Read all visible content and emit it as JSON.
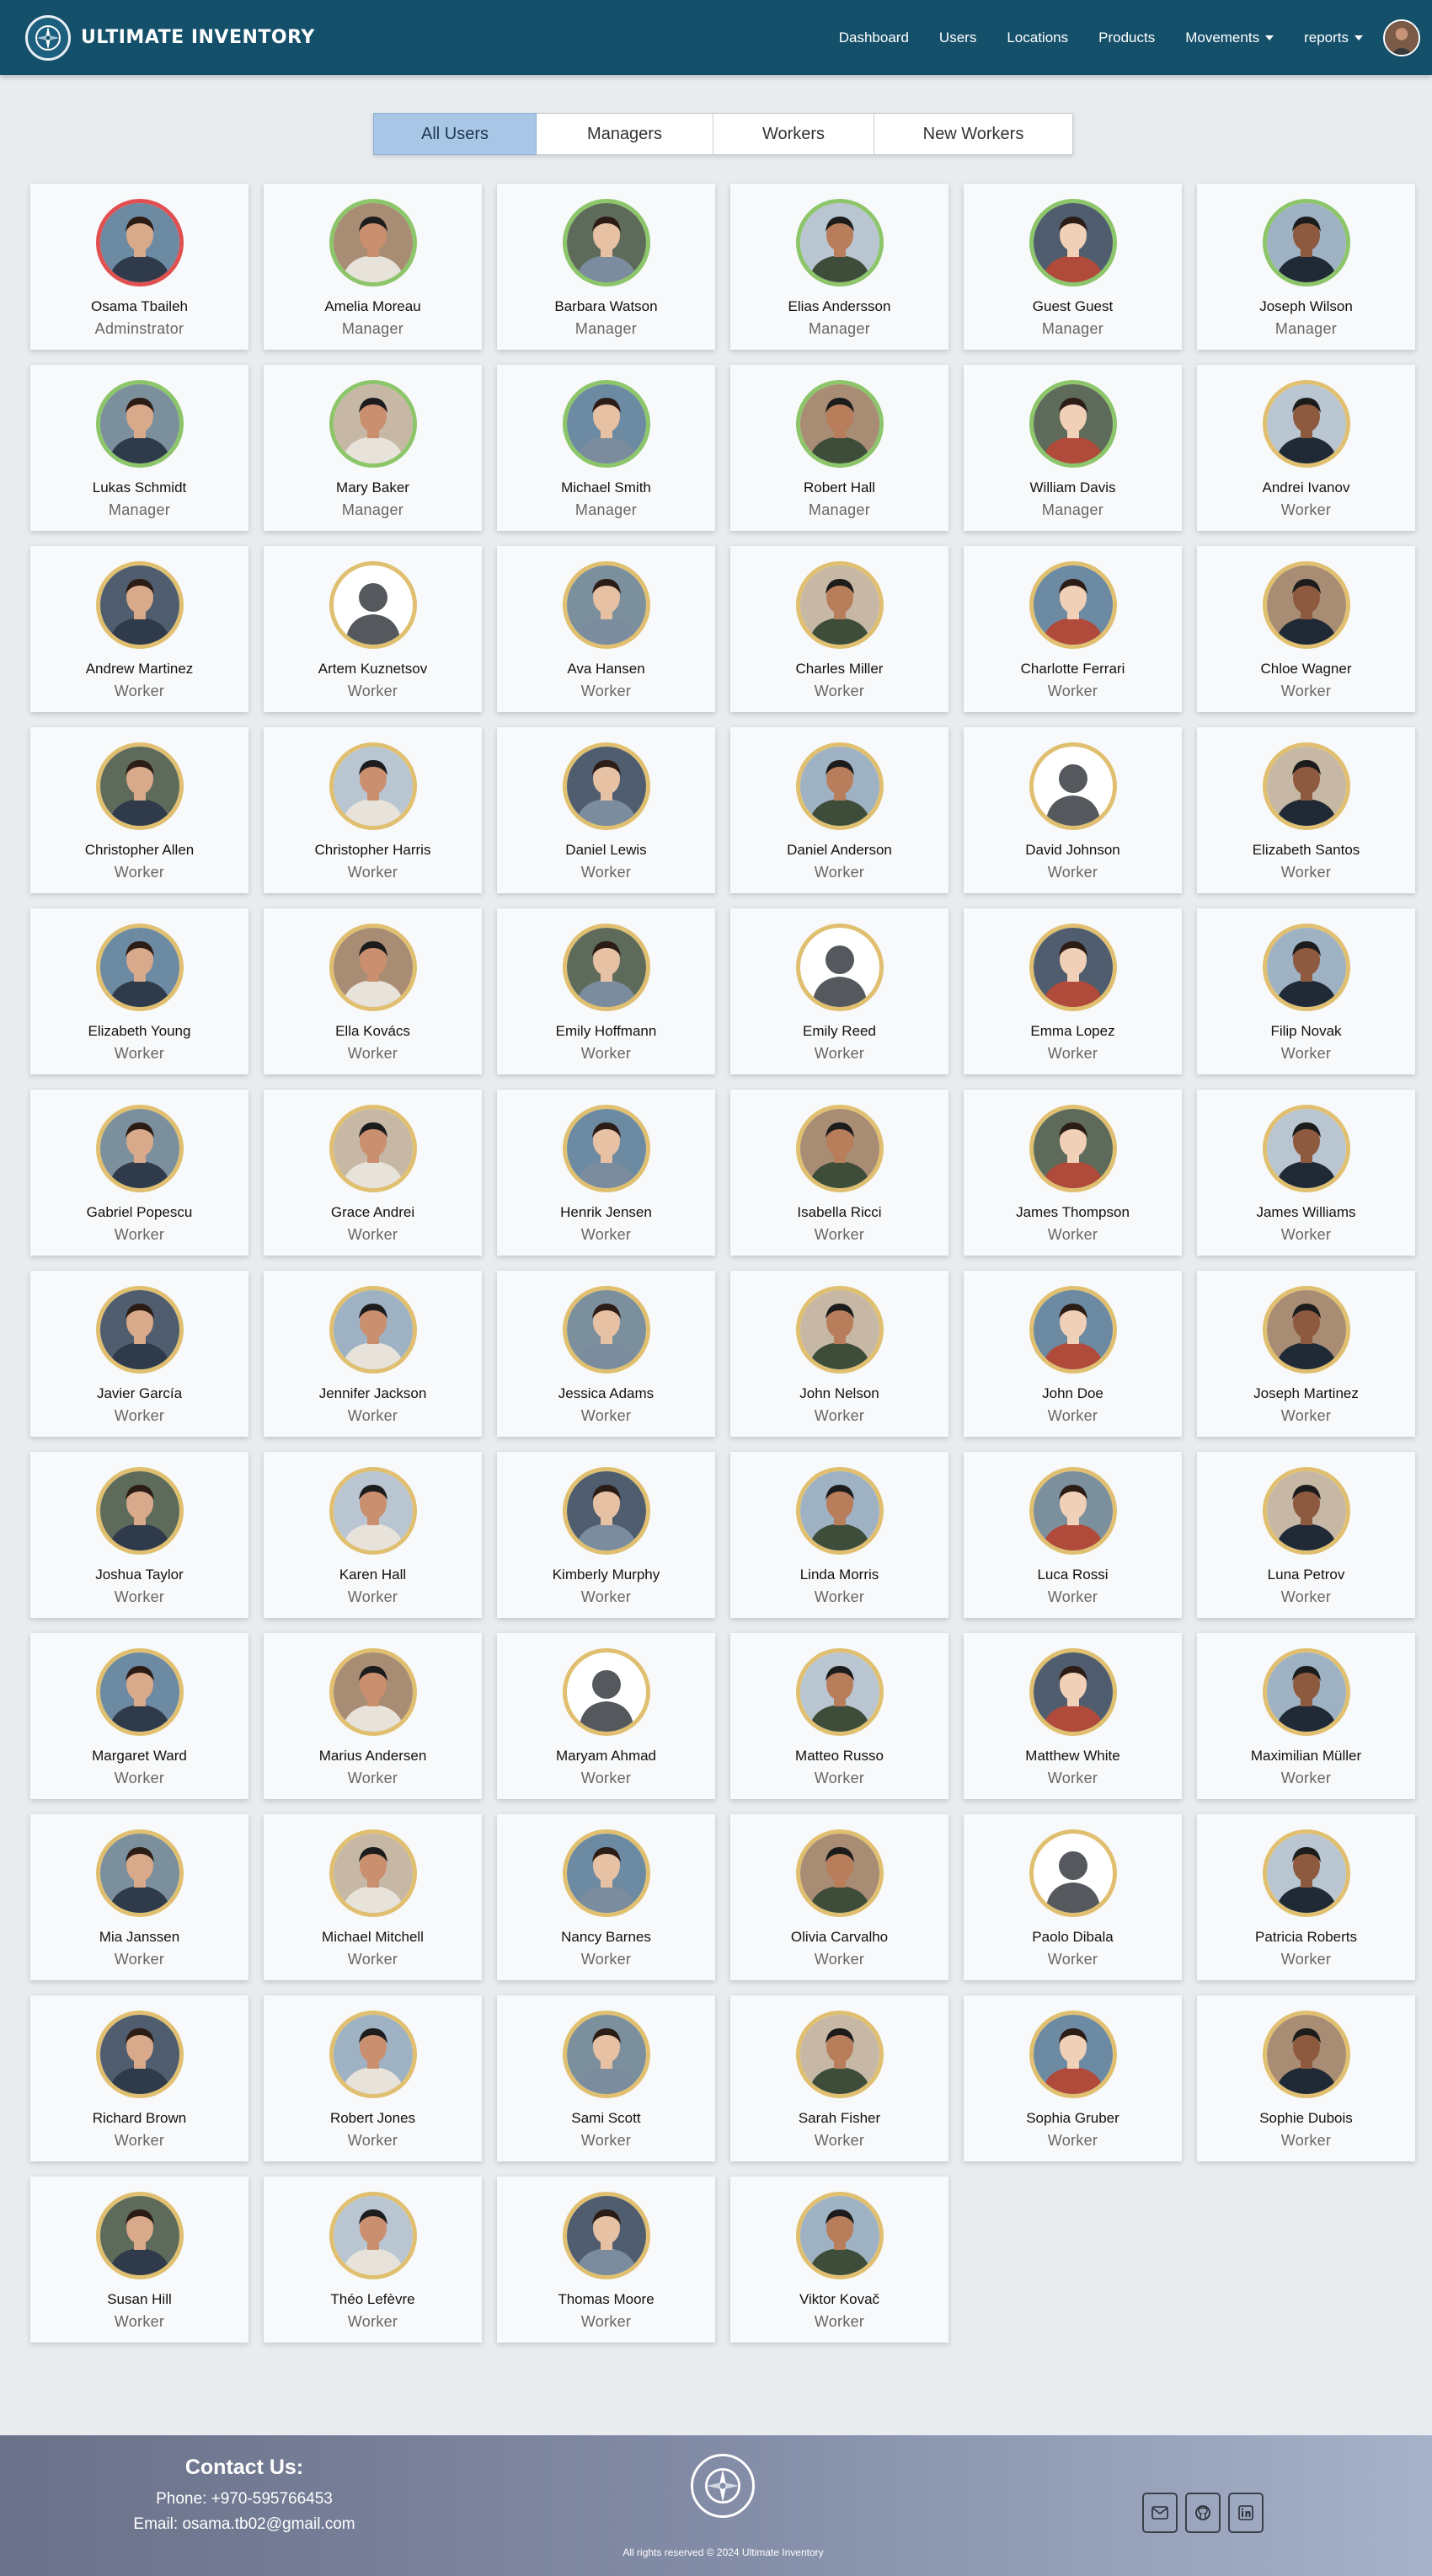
{
  "brand": {
    "name": "ULTIMATE INVENTORY"
  },
  "nav": {
    "dashboard": "Dashboard",
    "users": "Users",
    "locations": "Locations",
    "products": "Products",
    "movements": "Movements",
    "reports": "reports"
  },
  "tabs": [
    "All Users",
    "Managers",
    "Workers",
    "New Workers"
  ],
  "active_tab": "All Users",
  "colors": {
    "admin_ring": "#e05050",
    "manager_ring": "#8cc56a",
    "worker_ring": "#e0c070",
    "navbar": "#15506b",
    "active_tab": "#a8c6e6"
  },
  "users": [
    {
      "name": "Osama Tbaileh",
      "role": "Adminstrator"
    },
    {
      "name": "Amelia Moreau",
      "role": "Manager"
    },
    {
      "name": "Barbara Watson",
      "role": "Manager"
    },
    {
      "name": "Elias Andersson",
      "role": "Manager"
    },
    {
      "name": "Guest Guest",
      "role": "Manager"
    },
    {
      "name": "Joseph Wilson",
      "role": "Manager"
    },
    {
      "name": "Lukas Schmidt",
      "role": "Manager"
    },
    {
      "name": "Mary Baker",
      "role": "Manager"
    },
    {
      "name": "Michael Smith",
      "role": "Manager"
    },
    {
      "name": "Robert Hall",
      "role": "Manager"
    },
    {
      "name": "William Davis",
      "role": "Manager"
    },
    {
      "name": "Andrei Ivanov",
      "role": "Worker"
    },
    {
      "name": "Andrew Martinez",
      "role": "Worker"
    },
    {
      "name": "Artem Kuznetsov",
      "role": "Worker"
    },
    {
      "name": "Ava Hansen",
      "role": "Worker"
    },
    {
      "name": "Charles Miller",
      "role": "Worker"
    },
    {
      "name": "Charlotte Ferrari",
      "role": "Worker"
    },
    {
      "name": "Chloe Wagner",
      "role": "Worker"
    },
    {
      "name": "Christopher Allen",
      "role": "Worker"
    },
    {
      "name": "Christopher Harris",
      "role": "Worker"
    },
    {
      "name": "Daniel Lewis",
      "role": "Worker"
    },
    {
      "name": "Daniel Anderson",
      "role": "Worker"
    },
    {
      "name": "David Johnson",
      "role": "Worker"
    },
    {
      "name": "Elizabeth Santos",
      "role": "Worker"
    },
    {
      "name": "Elizabeth Young",
      "role": "Worker"
    },
    {
      "name": "Ella Kovács",
      "role": "Worker"
    },
    {
      "name": "Emily Hoffmann",
      "role": "Worker"
    },
    {
      "name": "Emily Reed",
      "role": "Worker"
    },
    {
      "name": "Emma Lopez",
      "role": "Worker"
    },
    {
      "name": "Filip Novak",
      "role": "Worker"
    },
    {
      "name": "Gabriel Popescu",
      "role": "Worker"
    },
    {
      "name": "Grace Andrei",
      "role": "Worker"
    },
    {
      "name": "Henrik Jensen",
      "role": "Worker"
    },
    {
      "name": "Isabella Ricci",
      "role": "Worker"
    },
    {
      "name": "James Thompson",
      "role": "Worker"
    },
    {
      "name": "James Williams",
      "role": "Worker"
    },
    {
      "name": "Javier García",
      "role": "Worker"
    },
    {
      "name": "Jennifer Jackson",
      "role": "Worker"
    },
    {
      "name": "Jessica Adams",
      "role": "Worker"
    },
    {
      "name": "John Nelson",
      "role": "Worker"
    },
    {
      "name": "John Doe",
      "role": "Worker"
    },
    {
      "name": "Joseph Martinez",
      "role": "Worker"
    },
    {
      "name": "Joshua Taylor",
      "role": "Worker"
    },
    {
      "name": "Karen Hall",
      "role": "Worker"
    },
    {
      "name": "Kimberly Murphy",
      "role": "Worker"
    },
    {
      "name": "Linda Morris",
      "role": "Worker"
    },
    {
      "name": "Luca Rossi",
      "role": "Worker"
    },
    {
      "name": "Luna Petrov",
      "role": "Worker"
    },
    {
      "name": "Margaret Ward",
      "role": "Worker"
    },
    {
      "name": "Marius Andersen",
      "role": "Worker"
    },
    {
      "name": "Maryam Ahmad",
      "role": "Worker"
    },
    {
      "name": "Matteo Russo",
      "role": "Worker"
    },
    {
      "name": "Matthew White",
      "role": "Worker"
    },
    {
      "name": "Maximilian Müller",
      "role": "Worker"
    },
    {
      "name": "Mia Janssen",
      "role": "Worker"
    },
    {
      "name": "Michael Mitchell",
      "role": "Worker"
    },
    {
      "name": "Nancy Barnes",
      "role": "Worker"
    },
    {
      "name": "Olivia Carvalho",
      "role": "Worker"
    },
    {
      "name": "Paolo Dibala",
      "role": "Worker"
    },
    {
      "name": "Patricia Roberts",
      "role": "Worker"
    },
    {
      "name": "Richard Brown",
      "role": "Worker"
    },
    {
      "name": "Robert Jones",
      "role": "Worker"
    },
    {
      "name": "Sami Scott",
      "role": "Worker"
    },
    {
      "name": "Sarah Fisher",
      "role": "Worker"
    },
    {
      "name": "Sophia Gruber",
      "role": "Worker"
    },
    {
      "name": "Sophie Dubois",
      "role": "Worker"
    },
    {
      "name": "Susan Hill",
      "role": "Worker"
    },
    {
      "name": "Théo Lefèvre",
      "role": "Worker"
    },
    {
      "name": "Thomas Moore",
      "role": "Worker"
    },
    {
      "name": "Viktor Kovač",
      "role": "Worker"
    }
  ],
  "footer": {
    "contact_title": "Contact Us:",
    "phone": "Phone: +970-595766453",
    "email": "Email: osama.tb02@gmail.com",
    "copyright": "All rights reserved © 2024 Ultimate Inventory",
    "social_icons": [
      "mail-icon",
      "github-icon",
      "linkedin-icon"
    ]
  }
}
